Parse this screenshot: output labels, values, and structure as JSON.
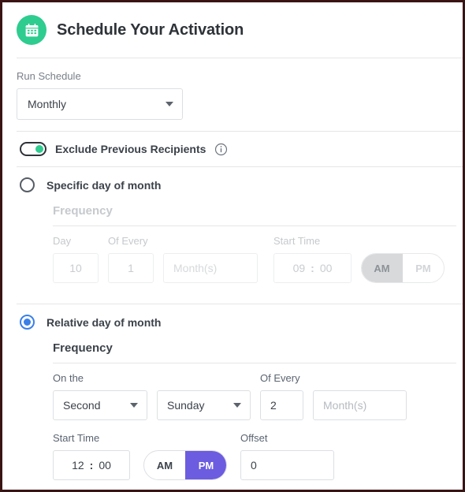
{
  "header": {
    "icon": "calendar-icon",
    "title": "Schedule Your Activation",
    "accent_color": "#2ecc8f"
  },
  "run_schedule": {
    "label": "Run Schedule",
    "value": "Monthly",
    "caret_icon": "chevron-down-icon"
  },
  "exclude_toggle": {
    "label": "Exclude Previous Recipients",
    "state": "on",
    "knob_color": "#2ecc8f",
    "info_icon": "info-icon"
  },
  "specific_day": {
    "radio_label": "Specific day of month",
    "selected": false,
    "disabled": true,
    "frequency_title": "Frequency",
    "day_label": "Day",
    "day_value": "10",
    "of_every_label": "Of Every",
    "of_every_value": "1",
    "unit_placeholder": "Month(s)",
    "start_time_label": "Start Time",
    "hour": "09",
    "separator": ":",
    "minute": "00",
    "am_label": "AM",
    "pm_label": "PM",
    "meridiem_selected": "AM"
  },
  "relative_day": {
    "radio_label": "Relative day of month",
    "selected": true,
    "disabled": false,
    "frequency_title": "Frequency",
    "on_the_label": "On the",
    "ordinal_value": "Second",
    "weekday_value": "Sunday",
    "of_every_label": "Of Every",
    "of_every_value": "2",
    "unit_placeholder": "Month(s)",
    "start_time_label": "Start Time",
    "hour": "12",
    "separator": ":",
    "minute": "00",
    "am_label": "AM",
    "pm_label": "PM",
    "meridiem_selected": "PM",
    "meridiem_accent": "#6c5ce0",
    "offset_label": "Offset",
    "offset_value": "0",
    "caret_icon": "chevron-down-icon"
  }
}
